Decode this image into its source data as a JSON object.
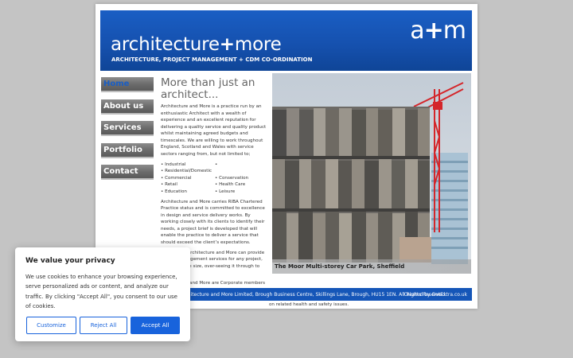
{
  "header": {
    "title_prefix": "architecture",
    "title_plus": "+",
    "title_suffix": "more",
    "subtitle": "ARCHITECTURE, PROJECT MANAGEMENT + CDM CO-ORDINATION",
    "logo_a": "a",
    "logo_plus": "+",
    "logo_m": "m"
  },
  "nav": {
    "items": [
      {
        "label": "Home"
      },
      {
        "label": "About us"
      },
      {
        "label": "Services"
      },
      {
        "label": "Portfolio"
      },
      {
        "label": "Contact"
      }
    ]
  },
  "content": {
    "heading": "More than just an architect...",
    "p1": "Architecture and More is a practice run by an enthusiastic Architect with a wealth of experience and an excellent reputation for delivering a quality service and quality product whilst maintaining agreed budgets and timescales. We are willing to work throughout England, Scotland and Wales with service sectors ranging from, but not limited to;",
    "list_left": [
      "Industrial",
      "Residential/Domestic",
      "Commercial",
      "Retail",
      "Education"
    ],
    "list_right": [
      "",
      "Conservation",
      "Health Care",
      "Leisure"
    ],
    "p2": "Architecture and More carries RIBA Chartered Practice status and is committed to excellence in design and service delivery works. By working closely with its clients to identify their needs, a project brief is developed that will enable the practice to deliver a service that should exceed the client’s expectations.",
    "p3": "In addition, Architecture and More can provide project management services for any project, no matter the size, over-seeing it through to completion.",
    "p4": "Architecture and More are Corporate members of the Association for Project Safety and can provide CDM Co-ordination services in addition to all other services, offering advice on related health and safety issues."
  },
  "photo": {
    "caption": "The Moor Multi-storey Car Park, Sheffield"
  },
  "footer": {
    "copyright": "Architecture and More Limited, Brough Business Centre, Skillings Lane, Brough, HU15 1EN. All Rights Reserved.",
    "credit": "Created by GetExtra.co.uk",
    "below_text": "on related health and safety issues."
  },
  "cookie": {
    "title": "We value your privacy",
    "text": "We use cookies to enhance your browsing experience, serve personalized ads or content, and analyze our traffic. By clicking \"Accept All\", you consent to our use of cookies.",
    "customize": "Customize",
    "reject": "Reject All",
    "accept": "Accept All"
  },
  "colors": {
    "brand_blue": "#1a5ec4",
    "cookie_blue": "#1863dc",
    "nav_grey": "#6a6a6a"
  }
}
